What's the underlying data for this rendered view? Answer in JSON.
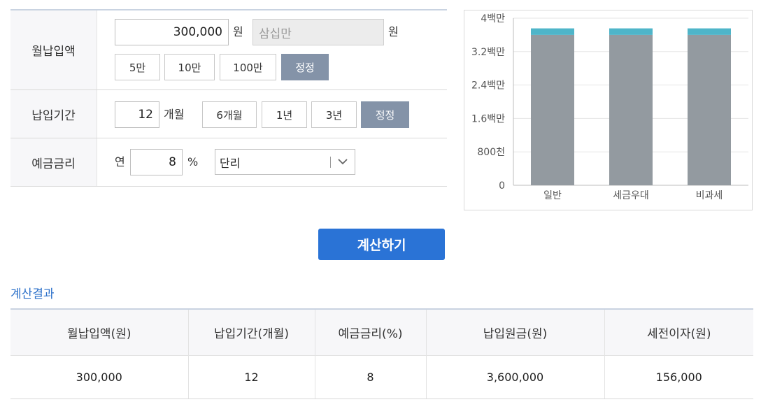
{
  "form": {
    "monthly": {
      "label": "월납입액",
      "value": "300,000",
      "unit": "원",
      "korean_value": "삼십만",
      "korean_unit": "원",
      "buttons": [
        "5만",
        "10만",
        "100만"
      ],
      "reset": "정정"
    },
    "period": {
      "label": "납입기간",
      "value": "12",
      "unit": "개월",
      "buttons": [
        "6개월",
        "1년",
        "3년"
      ],
      "reset": "정정"
    },
    "rate": {
      "label": "예금금리",
      "prefix": "연",
      "value": "8",
      "unit": "%",
      "type_selected": "단리"
    }
  },
  "calc_button": "계산하기",
  "result": {
    "title": "계산결과",
    "headers": [
      "월납입액(원)",
      "납입기간(개월)",
      "예금금리(%)",
      "납입원금(원)",
      "세전이자(원)"
    ],
    "row": [
      "300,000",
      "12",
      "8",
      "3,600,000",
      "156,000"
    ]
  },
  "chart_data": {
    "type": "bar",
    "stacked": true,
    "categories": [
      "일반",
      "세금우대",
      "비과세"
    ],
    "series": [
      {
        "values": [
          3600000,
          3600000,
          3600000
        ],
        "color": "#939aa0"
      },
      {
        "values": [
          156000,
          156000,
          156000
        ],
        "color": "#4fb5c9"
      }
    ],
    "ylim": [
      0,
      4000000
    ],
    "yticks": [
      0,
      800000,
      1600000,
      2400000,
      3200000,
      4000000
    ],
    "ytick_labels": [
      "0",
      "800천",
      "1.6백만",
      "2.4백만",
      "3.2백만",
      "4백만"
    ],
    "grid": true
  }
}
